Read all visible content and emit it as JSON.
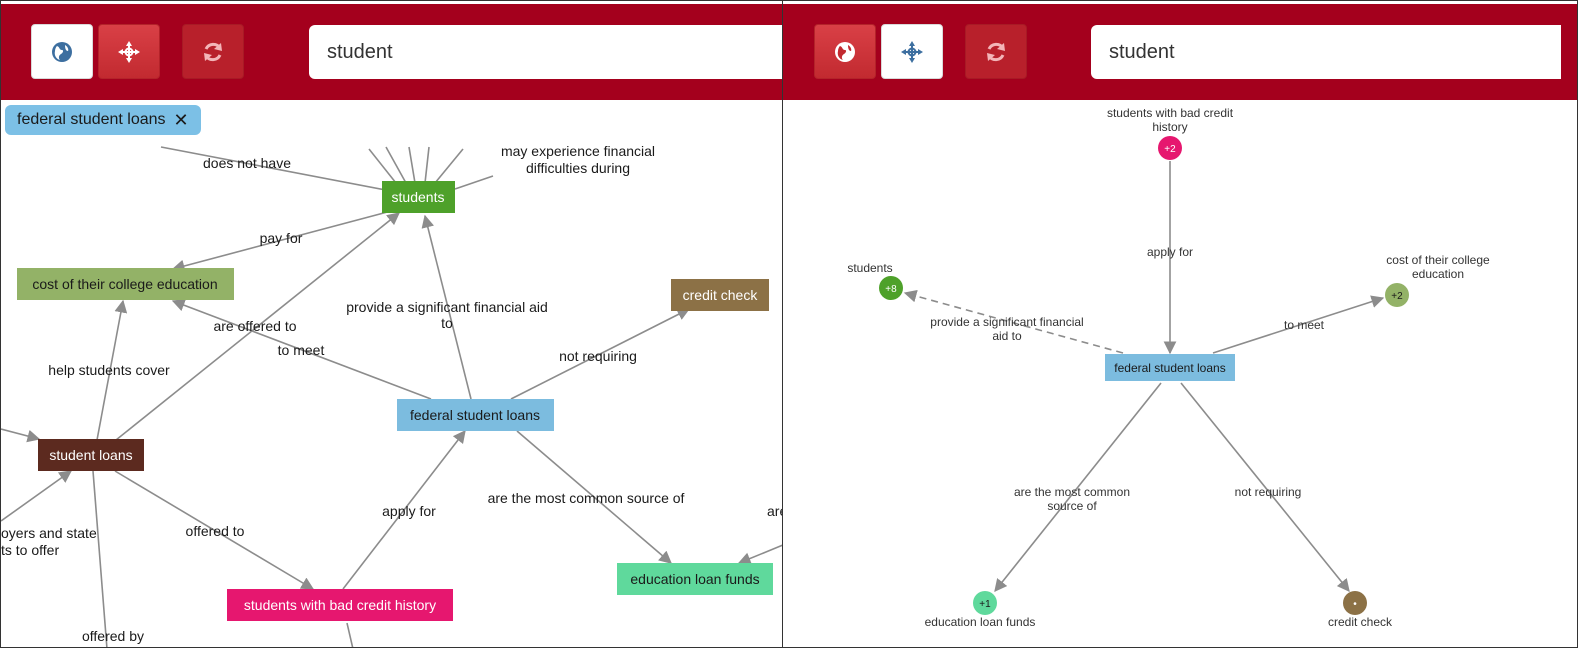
{
  "left_panel": {
    "search_value": "student",
    "toolbar_icons": [
      "globe-icon",
      "crosshair-icon",
      "refresh-icon"
    ],
    "filter_chip": {
      "label": "federal student loans",
      "close": "✕"
    },
    "nodes": {
      "students": "students",
      "cost": "cost of their college education",
      "credit_check": "credit check",
      "federal": "federal student loans",
      "student_loans": "student loans",
      "bad_credit": "students with bad credit history",
      "edu_funds": "education loan funds"
    },
    "edge_labels": {
      "does_not_have": "does not have",
      "fin_diff_1": "may experience financial",
      "fin_diff_2": "difficulties during",
      "pay_for": "pay for",
      "provide_1": "provide a significant financial aid",
      "provide_2": "to",
      "not_requiring": "not requiring",
      "are_offered_to": "are offered to",
      "to_meet": "to meet",
      "help_cover": "help students cover",
      "offered_to": "offered to",
      "apply_for": "apply for",
      "most_common": "are the most common source of",
      "employers_1": "oyers and state",
      "employers_2": "ts to offer",
      "offered_by": "offered by",
      "are_cut": "are"
    },
    "colors": {
      "students": "#4ea12a",
      "cost": "#93b267",
      "credit_check": "#8c7146",
      "federal": "#7cbcdf",
      "student_loans": "#5c2a1f",
      "bad_credit": "#e6176f",
      "edu_funds": "#5fd99c"
    }
  },
  "right_panel": {
    "search_value": "student",
    "toolbar_icons": [
      "globe-icon",
      "crosshair-icon",
      "refresh-icon"
    ],
    "center_node": "federal student loans",
    "nodes": [
      {
        "id": "bad_credit",
        "label_1": "students with bad credit",
        "label_2": "history",
        "badge": "+2",
        "color": "#e6176f"
      },
      {
        "id": "students",
        "label_1": "students",
        "label_2": "",
        "badge": "+8",
        "color": "#4ea12a"
      },
      {
        "id": "cost",
        "label_1": "cost of their college",
        "label_2": "education",
        "badge": "+2",
        "color": "#93b267"
      },
      {
        "id": "edu_funds",
        "label_1": "education loan funds",
        "label_2": "",
        "badge": "+1",
        "color": "#5fd99c"
      },
      {
        "id": "credit_check",
        "label_1": "credit check",
        "label_2": "",
        "badge": "•",
        "color": "#8c7146"
      }
    ],
    "edge_labels": {
      "apply_for": "apply for",
      "provide_1": "provide a significant financial",
      "provide_2": "aid to",
      "to_meet": "to meet",
      "most_common_1": "are the most common",
      "most_common_2": "source of",
      "not_requiring": "not requiring"
    }
  }
}
